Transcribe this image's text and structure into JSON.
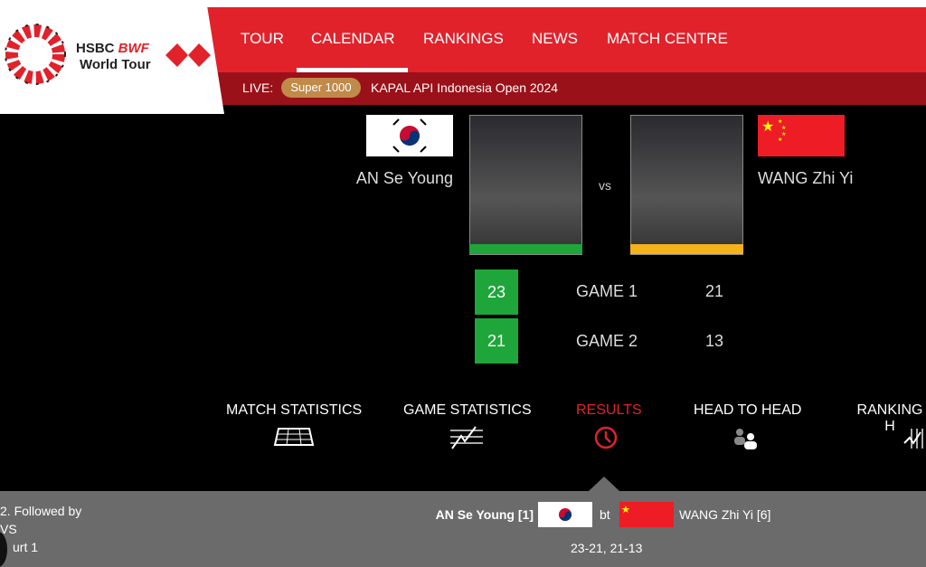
{
  "header": {
    "logo_text": "HSBC BWF World Tour",
    "nav": [
      "TOUR",
      "CALENDAR",
      "RANKINGS",
      "NEWS",
      "MATCH CENTRE"
    ],
    "active_nav": "CALENDAR",
    "live_label": "LIVE:",
    "live_badge": "Super 1000",
    "live_event": "KAPAL API Indonesia Open 2024"
  },
  "match": {
    "player1": {
      "name": "AN Se Young",
      "country": "Korea",
      "bar_color": "#1ea63a"
    },
    "vs": "vs",
    "player2": {
      "name": "WANG Zhi Yi",
      "country": "China",
      "bar_color": "#f5b21b"
    },
    "games": [
      {
        "label": "GAME 1",
        "p1": "23",
        "p2": "21"
      },
      {
        "label": "GAME 2",
        "p1": "21",
        "p2": "13"
      }
    ],
    "winner_color": "#1ea63a"
  },
  "tabs": [
    {
      "label": "MATCH STATISTICS",
      "icon": "court-icon"
    },
    {
      "label": "GAME STATISTICS",
      "icon": "chart-lines-icon"
    },
    {
      "label": "RESULTS",
      "icon": "clock-icon",
      "active": true
    },
    {
      "label": "HEAD TO HEAD",
      "icon": "players-icon"
    },
    {
      "label": "RANKING H",
      "icon": "ranking-icon"
    }
  ],
  "results": {
    "left_lines": [
      "2. Followed by",
      "VS",
      "urt 1"
    ],
    "p1": "AN Se Young [1]",
    "bt": "bt",
    "p2": "WANG Zhi Yi [6]",
    "score": "23-21, 21-13"
  },
  "colors": {
    "accent": "#e1222b",
    "live_strip": "#9b1119",
    "badge": "#c08a4a",
    "panel": "#6b6b6b"
  }
}
